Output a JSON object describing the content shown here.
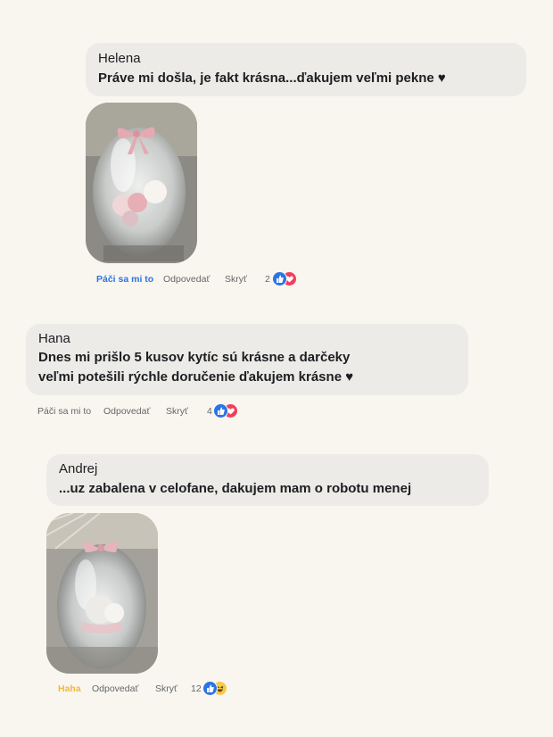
{
  "comments": [
    {
      "author": "Helena",
      "text_lines": [
        "Práve mi došla, je fakt krásna...ďakujem veľmi pekne ♥"
      ],
      "actions": {
        "reaction": "Páči sa mi to",
        "reply": "Odpovedať",
        "hide": "Skryť"
      },
      "reaction_count": "2",
      "reaction_icons": [
        "like-icon",
        "love-icon"
      ]
    },
    {
      "author": "Hana",
      "text_lines": [
        "Dnes mi prišlo 5 kusov kytíc sú krásne a darčeky",
        "veľmi potešili rýchle doručenie ďakujem krásne ♥"
      ],
      "actions": {
        "reaction": "Páči sa mi to",
        "reply": "Odpovedať",
        "hide": "Skryť"
      },
      "reaction_count": "4",
      "reaction_icons": [
        "like-icon",
        "love-icon"
      ]
    },
    {
      "author": "Andrej",
      "text_lines": [
        "...uz zabalena v celofane, dakujem mam o robotu menej"
      ],
      "actions": {
        "reaction": "Haha",
        "reply": "Odpovedať",
        "hide": "Skryť"
      },
      "reaction_count": "12",
      "reaction_icons": [
        "like-icon",
        "haha-icon"
      ]
    }
  ],
  "colors": {
    "background": "#f9f6f0",
    "bubble": "#ecebe8",
    "like_blue": "#2a74e6",
    "love_red": "#f33e58",
    "haha_yellow": "#f2b93a",
    "meta_gray": "#65676b"
  }
}
